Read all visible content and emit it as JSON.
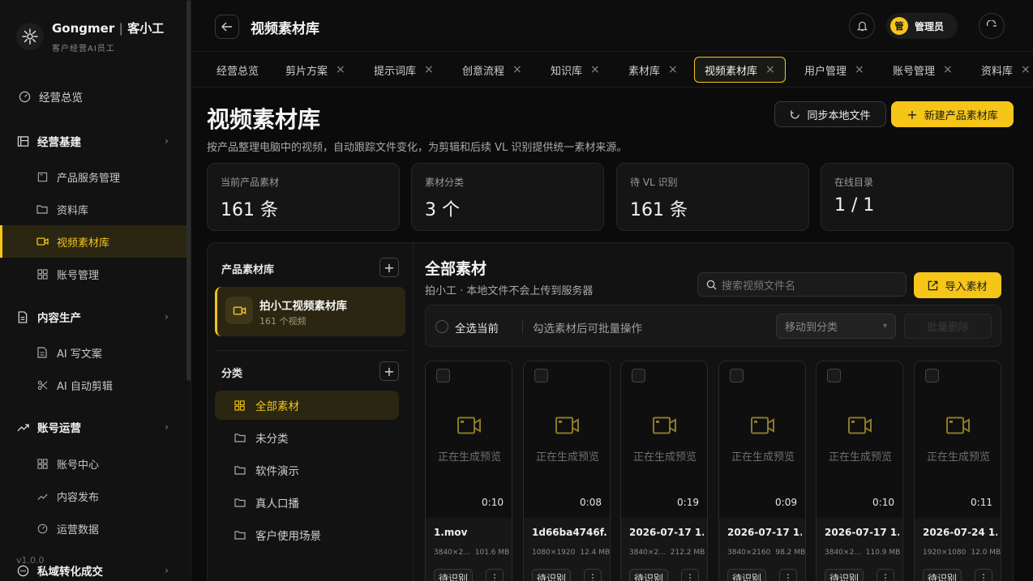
{
  "brand": {
    "name": "Gongmer",
    "name_cn": "客小工",
    "tagline": "客户经营AI员工"
  },
  "sidebar": {
    "items": [
      {
        "label": "经营总览",
        "icon": "gauge-icon"
      },
      {
        "label": "经营基建",
        "icon": "board-icon"
      },
      {
        "label": "产品服务管理",
        "icon": "box-icon"
      },
      {
        "label": "资料库",
        "icon": "folder-icon"
      },
      {
        "label": "视频素材库",
        "icon": "video-icon"
      },
      {
        "label": "账号管理",
        "icon": "grid-icon"
      },
      {
        "label": "内容生产",
        "icon": "document-icon"
      },
      {
        "label": "AI 写文案",
        "icon": "document-icon"
      },
      {
        "label": "AI 自动剪辑",
        "icon": "scissors-icon"
      },
      {
        "label": "账号运营",
        "icon": "trend-icon"
      },
      {
        "label": "账号中心",
        "icon": "grid-icon"
      },
      {
        "label": "内容发布",
        "icon": "trend-icon"
      },
      {
        "label": "运营数据",
        "icon": "gauge-icon"
      },
      {
        "label": "私域转化成交",
        "icon": "chat-icon"
      }
    ],
    "version": "v1.0.0"
  },
  "header": {
    "title": "视频素材库",
    "user": "管理员",
    "avatar_text": "管"
  },
  "tabs": [
    {
      "label": "经营总览"
    },
    {
      "label": "剪片方案"
    },
    {
      "label": "提示词库"
    },
    {
      "label": "创意流程"
    },
    {
      "label": "知识库"
    },
    {
      "label": "素材库"
    },
    {
      "label": "视频素材库"
    },
    {
      "label": "用户管理"
    },
    {
      "label": "账号管理"
    },
    {
      "label": "资料库"
    }
  ],
  "page": {
    "title": "视频素材库",
    "description": "按产品整理电脑中的视频，自动跟踪文件变化，为剪辑和后续 VL 识别提供统一素材来源。",
    "sync_label": "同步本地文件",
    "new_label": "新建产品素材库"
  },
  "stats": [
    {
      "label": "当前产品素材",
      "value": "161 条"
    },
    {
      "label": "素材分类",
      "value": "3 个"
    },
    {
      "label": "待 VL 识别",
      "value": "161 条"
    },
    {
      "label": "在线目录",
      "value": "1 / 1"
    }
  ],
  "library": {
    "title": "产品素材库",
    "card_name": "拍小工视频素材库",
    "card_count": "161 个视频",
    "categories_title": "分类",
    "categories": [
      "全部素材",
      "未分类",
      "软件演示",
      "真人口播",
      "客户使用场景"
    ]
  },
  "content": {
    "title": "全部素材",
    "subtitle": "拍小工 · 本地文件不会上传到服务器",
    "search_placeholder": "搜索视频文件名",
    "import_label": "导入素材",
    "select_all": "全选当前",
    "hint": "勾选素材后可批量操作",
    "move_placeholder": "移动到分类",
    "batch_label": "批量删除",
    "preview_text": "正在生成预览",
    "status_label": "待识别"
  },
  "videos": [
    {
      "name": "1.mov",
      "res": "3840×2...",
      "size": "101.6 MB",
      "duration": "0:10"
    },
    {
      "name": "1d66ba4746f...",
      "res": "1080×1920",
      "size": "12.4 MB",
      "duration": "0:08"
    },
    {
      "name": "2026-07-17 1...",
      "res": "3840×2...",
      "size": "212.2 MB",
      "duration": "0:19"
    },
    {
      "name": "2026-07-17 1...",
      "res": "3840×2160",
      "size": "98.2 MB",
      "duration": "0:09"
    },
    {
      "name": "2026-07-17 1...",
      "res": "3840×2...",
      "size": "110.9 MB",
      "duration": "0:10"
    },
    {
      "name": "2026-07-24 1...",
      "res": "1920×1080",
      "size": "12.0 MB",
      "duration": "0:11"
    }
  ],
  "colors": {
    "accent": "#f5c518",
    "bg": "#0b0b0c",
    "panel": "#121212"
  }
}
